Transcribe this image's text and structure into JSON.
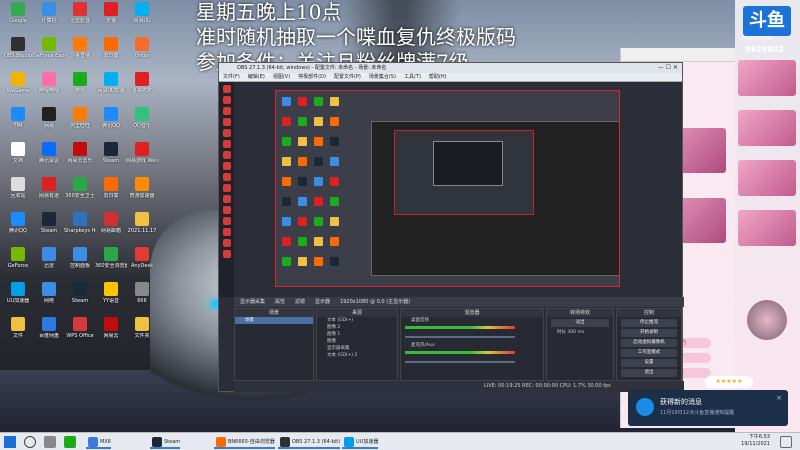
{
  "overlay": {
    "line1": "星期五晚上10点",
    "line2": "准时随机抽取一个喋血复仇终极版码",
    "line3": "参加条件：关注且粉丝牌满7级"
  },
  "desktop_icons": [
    {
      "label": "Google",
      "color": "#34a853"
    },
    {
      "label": "OBS Studio",
      "color": "#303030"
    },
    {
      "label": "WeGame",
      "color": "#f0b400"
    },
    {
      "label": "TIM",
      "color": "#1a8cff"
    },
    {
      "label": "文档",
      "color": "#ffffff"
    },
    {
      "label": "回收站",
      "color": "#dddddd"
    },
    {
      "label": "腾讯QQ",
      "color": "#1a8cff"
    },
    {
      "label": "GeForce",
      "color": "#76b900"
    },
    {
      "label": "UU加速器",
      "color": "#00a0e9"
    },
    {
      "label": "文件",
      "color": "#f0c040"
    },
    {
      "label": "计算机",
      "color": "#3a8ee6"
    },
    {
      "label": "GeForce Experience",
      "color": "#76b900"
    },
    {
      "label": "哔哩哔哩",
      "color": "#ff6fa6"
    },
    {
      "label": "网易",
      "color": "#222222"
    },
    {
      "label": "腾讯会议",
      "color": "#0a6cff"
    },
    {
      "label": "网易有道",
      "color": "#e02020"
    },
    {
      "label": "Steam",
      "color": "#1b2838"
    },
    {
      "label": "迅雷",
      "color": "#3c8be8"
    },
    {
      "label": "网络",
      "color": "#3a8ee6"
    },
    {
      "label": "百度网盘",
      "color": "#2a7ae2"
    },
    {
      "label": "迅雷影音",
      "color": "#e03030"
    },
    {
      "label": "斗鱼直播",
      "color": "#ff7a00"
    },
    {
      "label": "微信",
      "color": "#1aad19"
    },
    {
      "label": "阿里旺旺",
      "color": "#ff7a00"
    },
    {
      "label": "网易云音乐",
      "color": "#c20c0c"
    },
    {
      "label": "360安全卫士",
      "color": "#2aa84a"
    },
    {
      "label": "Sharpkeys Holmes",
      "color": "#3070c0"
    },
    {
      "label": "控制面板",
      "color": "#3a8ee6"
    },
    {
      "label": "Steam",
      "color": "#1b2838"
    },
    {
      "label": "WPS Office",
      "color": "#d73a3a"
    },
    {
      "label": "天猫",
      "color": "#e02020"
    },
    {
      "label": "向日葵",
      "color": "#ff6a00"
    },
    {
      "label": "网易UU加速",
      "color": "#00b0f0"
    },
    {
      "label": "腾讯QQ",
      "color": "#1a8cff"
    },
    {
      "label": "Steam",
      "color": "#1b2838"
    },
    {
      "label": "向日葵",
      "color": "#ff6a00"
    },
    {
      "label": "网易邮箱",
      "color": "#d03030"
    },
    {
      "label": "360安全浏览器",
      "color": "#2aa84a"
    },
    {
      "label": "YY语音",
      "color": "#ffc400"
    },
    {
      "label": "网易云",
      "color": "#c20c0c"
    },
    {
      "label": "网易UU",
      "color": "#00b0f0"
    },
    {
      "label": "Origin",
      "color": "#f56c2d"
    },
    {
      "label": "金舟PDF",
      "color": "#e02020"
    },
    {
      "label": "QQ音乐",
      "color": "#31c27c"
    },
    {
      "label": "网易游戏 Welcome",
      "color": "#e02020"
    },
    {
      "label": "奇游加速器",
      "color": "#ff8c00"
    },
    {
      "label": "2021.11.17",
      "color": "#f0c040"
    },
    {
      "label": "AnyDesk",
      "color": "#e03c31"
    },
    {
      "label": "666",
      "color": "#888888"
    },
    {
      "label": "文件夹",
      "color": "#f0c040"
    }
  ],
  "obs": {
    "title": "OBS 27.1.3 (64-bit, windows) - 配置文件: 未命名 - 场景: 未命名",
    "menu": [
      "文件(F)",
      "编辑(E)",
      "视图(V)",
      "停靠部件(D)",
      "配置文件(P)",
      "场景集合(S)",
      "工具(T)",
      "帮助(H)"
    ],
    "scenebar": [
      "显示器采集",
      "属性",
      "滤镜",
      "显示器",
      "1920x1080 @ 0,0 (主显示器)"
    ],
    "docks": {
      "scenes": {
        "title": "场景",
        "items": [
          "场景"
        ]
      },
      "sources": {
        "title": "来源",
        "items": [
          "文本 (GDI+)",
          "图像 2",
          "图像 1",
          "图像",
          "显示器采集",
          "文本 (GDI+) 2"
        ]
      },
      "mixer": {
        "title": "混音器",
        "channels": [
          "桌面音频",
          "麦克风/Aux"
        ]
      },
      "transitions": {
        "title": "转场特效",
        "type": "淡出",
        "duration_label": "时长",
        "duration": "300 ms"
      },
      "controls": {
        "title": "控制",
        "buttons": [
          "停止推流",
          "开始录制",
          "启动虚拟摄像机",
          "工作室模式",
          "设置",
          "退出"
        ]
      }
    },
    "status": "LIVE: 00:19:25  REC: 00:00:00  CPU: 1.7%  30.00 fps"
  },
  "browser": {
    "pills": [
      "立即预约",
      "关注",
      "送礼物"
    ]
  },
  "douyu": {
    "logo": "斗鱼",
    "site": "DOUYU.COM",
    "count": "9629842"
  },
  "notification": {
    "title": "获得新的消息",
    "body": "11月19日12点斗鱼直播通知提醒",
    "close": "×"
  },
  "rating": "★★★★★",
  "taskbar": {
    "items": [
      {
        "label": "MX6",
        "color": "#3a7bd5"
      },
      {
        "label": "Steam",
        "color": "#1b2838"
      },
      {
        "label": "BN6665-自由浏览器",
        "color": "#ff6a00"
      },
      {
        "label": "OBS 27.1.3 (64-bit)",
        "color": "#303030"
      },
      {
        "label": "UU加速器",
        "color": "#00a0e9"
      }
    ],
    "time": "下午6:53",
    "date": "19/11/2021"
  }
}
